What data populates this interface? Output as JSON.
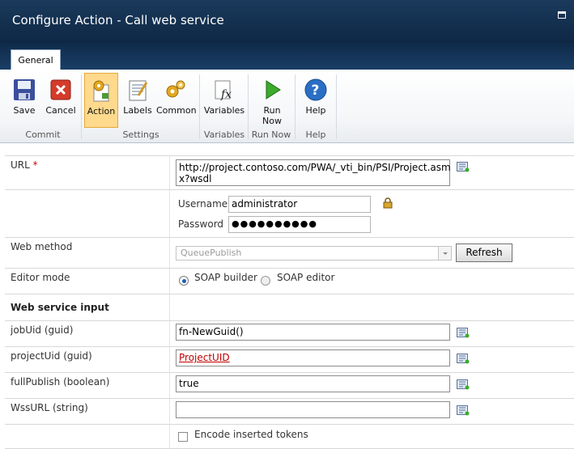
{
  "window": {
    "title": "Configure Action - Call web service"
  },
  "tabs": [
    {
      "label": "General"
    }
  ],
  "ribbon": {
    "buttons": {
      "save": "Save",
      "cancel": "Cancel",
      "action": "Action",
      "labels": "Labels",
      "common": "Common",
      "variables": "Variables",
      "run_now_1": "Run",
      "run_now_2": "Now",
      "help": "Help"
    },
    "groups": {
      "commit": "Commit",
      "settings": "Settings",
      "variables": "Variables",
      "run_now": "Run Now",
      "help": "Help"
    }
  },
  "form": {
    "url": {
      "label": "URL",
      "required": "*",
      "value_line1": "http://project.contoso.com/PWA/_vti_bin/PSI/Project.asm",
      "value_line2": "x?wsdl"
    },
    "credentials": {
      "username_label": "Username",
      "username_value": "administrator",
      "password_label": "Password",
      "password_value": "●●●●●●●●●●"
    },
    "web_method": {
      "label": "Web method",
      "selected": "QueuePublish",
      "refresh_button": "Refresh"
    },
    "editor_mode": {
      "label": "Editor mode",
      "options": [
        "SOAP builder",
        "SOAP editor"
      ],
      "selected": "SOAP builder"
    },
    "section_title": "Web service input",
    "inputs": [
      {
        "label": "jobUid (guid)",
        "value": "fn-NewGuid()"
      },
      {
        "label": "projectUid (guid)",
        "value": "ProjectUID"
      },
      {
        "label": "fullPublish (boolean)",
        "value": "true"
      },
      {
        "label": "WssURL (string)",
        "value": ""
      }
    ],
    "encode_tokens_label": "Encode inserted tokens",
    "encode_tokens_checked": false
  },
  "colors": {
    "titlebar": "#1b3a5c",
    "selected_button": "#ffd98c",
    "token_link": "#c00000",
    "required": "#cc0000"
  }
}
